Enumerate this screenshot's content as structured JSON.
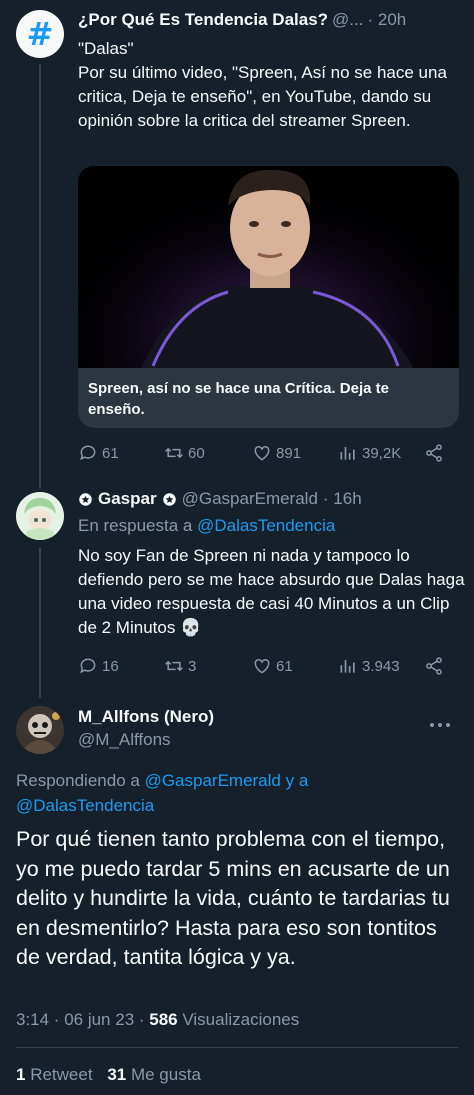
{
  "tweet1": {
    "author": "¿Por Qué Es Tendencia Dalas?",
    "handle": "@...",
    "time": "· 20h",
    "line1": "\"Dalas\"",
    "text": "Por su último video, \"Spreen,  Así no se hace una critica, Deja te enseño\", en YouTube, dando su opinión sobre la critica del streamer Spreen.",
    "media_caption": "Spreen, así no se hace una Crítica. Deja te enseño.",
    "replies": "61",
    "retweets": "60",
    "likes": "891",
    "views": "39,2K"
  },
  "tweet2": {
    "author": "Gaspar",
    "handle": "@GasparEmerald",
    "time": "· 16h",
    "reply_prefix": "En respuesta a",
    "reply_to": "@DalasTendencia",
    "text": "No soy Fan de Spreen ni nada y tampoco lo defiendo pero se me hace absurdo que Dalas haga una video respuesta de casi 40 Minutos a un Clip de 2 Minutos 💀",
    "replies": "16",
    "retweets": "3",
    "likes": "61",
    "views": "3.943"
  },
  "tweet3": {
    "author": "M_Allfons (Nero)",
    "handle": "@M_Alffons",
    "reply_prefix": "Respondiendo a",
    "reply_to_1": "@GasparEmerald y a",
    "reply_to_2": "@DalasTendencia",
    "text": "Por qué tienen tanto problema con el tiempo, yo me puedo tardar 5 mins en acusarte de un delito y hundirte la vida, cuánto te tardarias tu en desmentirlo? Hasta para eso son tontitos de verdad, tantita lógica y ya.",
    "timestamp": "3:14 · 06 jun 23 ·",
    "views_count": "586",
    "views_label": "Visualizaciones",
    "retweet_count": "1",
    "retweet_label": "Retweet",
    "like_count": "31",
    "like_label": "Me gusta"
  },
  "colors": {
    "background": "#15202b",
    "accent": "#1d9bf0",
    "muted": "#8b98a5",
    "text": "#f7f9f9",
    "divider": "#38444d"
  },
  "icons": [
    "hashtag-icon",
    "reply-icon",
    "retweet-icon",
    "like-icon",
    "views-icon",
    "share-icon",
    "more-icon",
    "verified-badge-icon"
  ]
}
